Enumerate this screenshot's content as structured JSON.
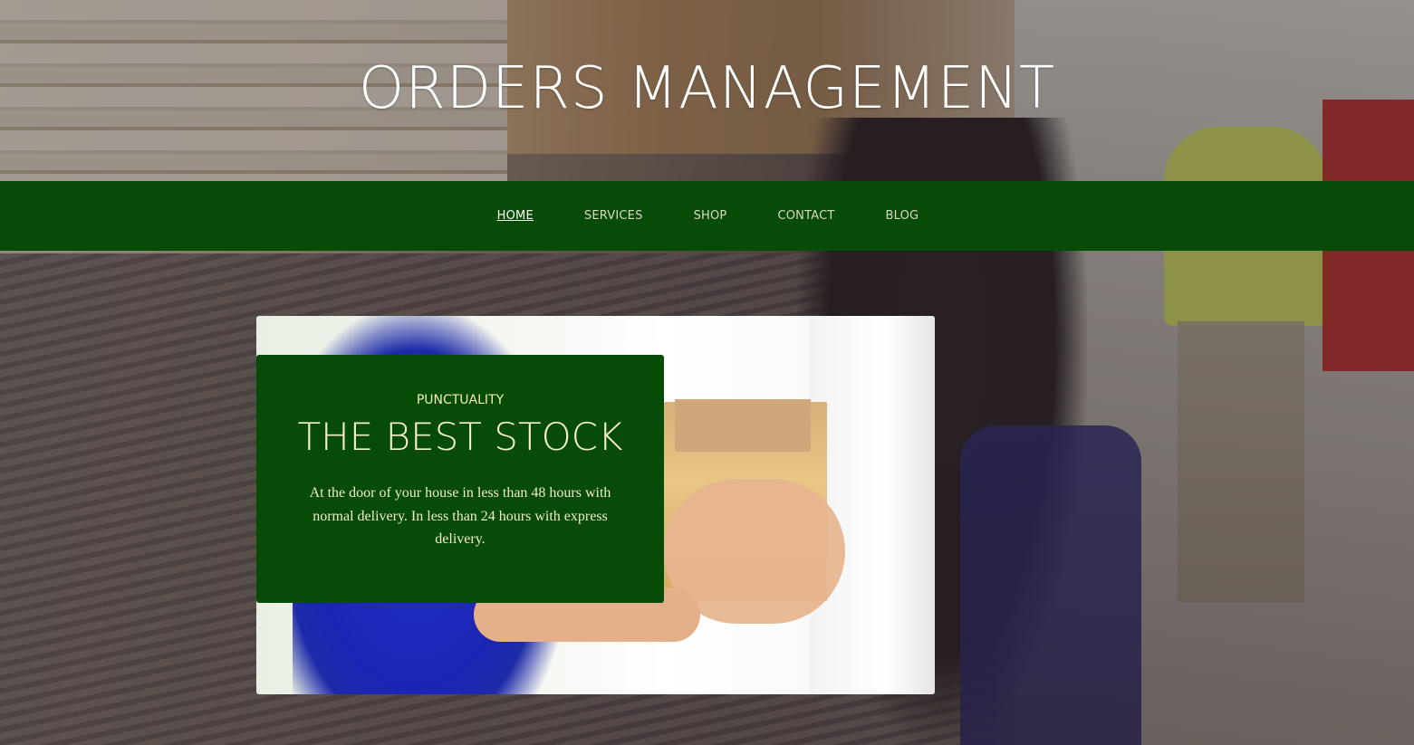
{
  "site": {
    "title": "ORDERS MANAGEMENT"
  },
  "nav": {
    "items": [
      {
        "label": "HOME",
        "active": true
      },
      {
        "label": "SERVICES",
        "active": false
      },
      {
        "label": "SHOP",
        "active": false
      },
      {
        "label": "CONTACT",
        "active": false
      },
      {
        "label": "BLOG",
        "active": false
      }
    ]
  },
  "promo": {
    "kicker": "PUNCTUALITY",
    "title": "THE BEST STOCK",
    "text": "At the door of your house in less than 48 hours with normal delivery. In less than 24 hours with express delivery."
  },
  "colors": {
    "brand_green": "#064b06",
    "nav_text": "#d9d9c2",
    "promo_text": "#f1ecc8"
  }
}
